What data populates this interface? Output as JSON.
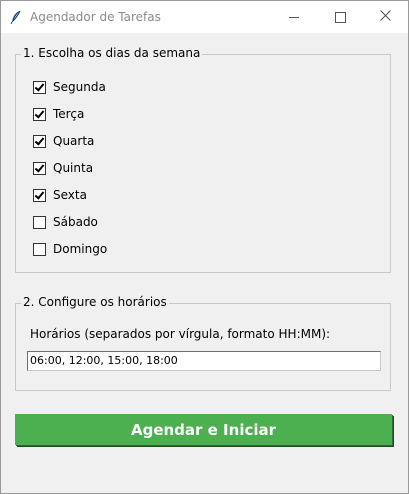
{
  "window": {
    "title": "Agendador de Tarefas",
    "icons": {
      "app": "feather-icon",
      "minimize": "minimize-icon",
      "maximize": "maximize-icon",
      "close": "close-icon"
    }
  },
  "days_section": {
    "legend": "1. Escolha os dias da semana",
    "days": [
      {
        "label": "Segunda",
        "checked": true
      },
      {
        "label": "Terça",
        "checked": true
      },
      {
        "label": "Quarta",
        "checked": true
      },
      {
        "label": "Quinta",
        "checked": true
      },
      {
        "label": "Sexta",
        "checked": true
      },
      {
        "label": "Sábado",
        "checked": false
      },
      {
        "label": "Domingo",
        "checked": false
      }
    ]
  },
  "times_section": {
    "legend": "2. Configure os horários",
    "hint": "Horários (separados por vírgula, formato HH:MM):",
    "value": "06:00, 12:00, 15:00, 18:00"
  },
  "actions": {
    "start_label": "Agendar e Iniciar",
    "start_color": "#4caf50"
  }
}
